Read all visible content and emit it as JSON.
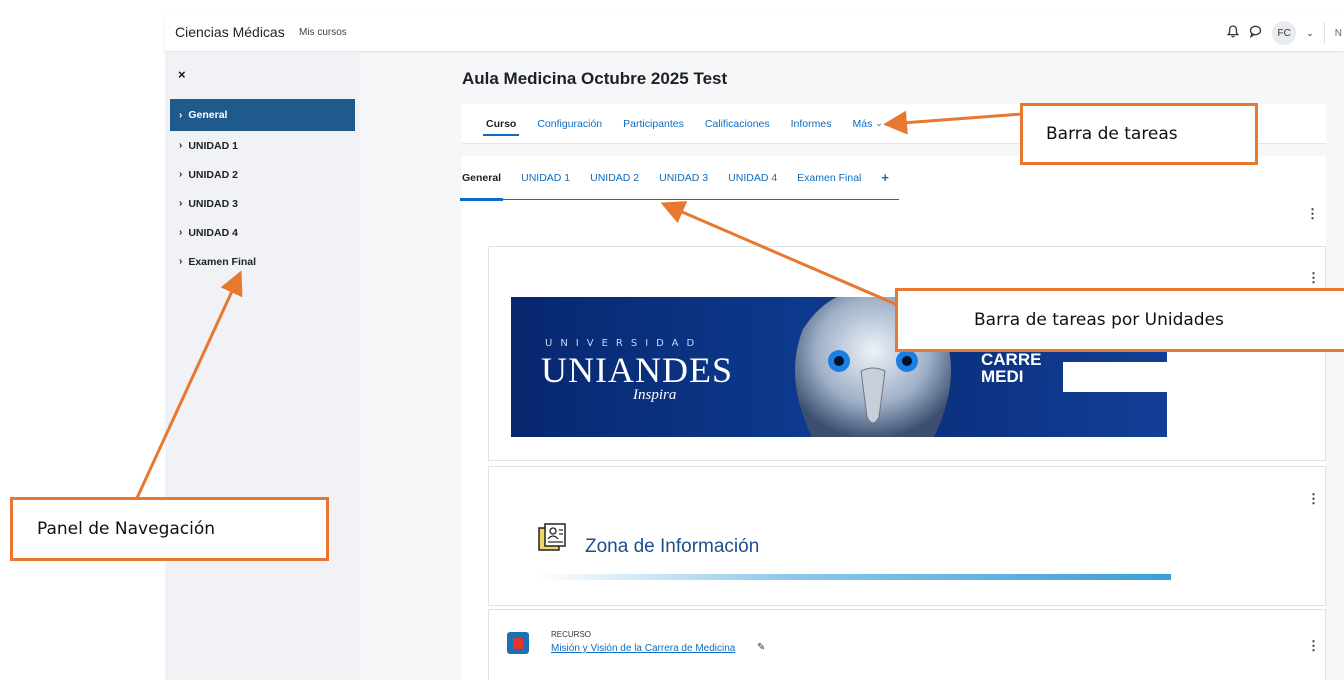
{
  "navbar": {
    "brand": "Ciencias Médicas",
    "link_mycourses": "Mis cursos",
    "avatar_initials": "FC",
    "cut_text": "N"
  },
  "drawer": {
    "close": "×",
    "items": [
      {
        "label": "General",
        "active": true
      },
      {
        "label": "UNIDAD 1"
      },
      {
        "label": "UNIDAD 2"
      },
      {
        "label": "UNIDAD 3"
      },
      {
        "label": "UNIDAD 4"
      },
      {
        "label": "Examen Final"
      }
    ]
  },
  "course": {
    "title": "Aula Medicina Octubre 2025 Test",
    "secondary_nav": [
      "Curso",
      "Configuración",
      "Participantes",
      "Calificaciones",
      "Informes",
      "Más"
    ],
    "unit_tabs": [
      "General",
      "UNIDAD 1",
      "UNIDAD 2",
      "UNIDAD 3",
      "UNIDAD 4",
      "Examen Final"
    ],
    "add_tab": "+"
  },
  "banner": {
    "university": "UNIVERSIDAD",
    "brand": "UNIANDES",
    "tagline": "Inspira",
    "career_line1": "CARRE",
    "career_line2": "MEDI"
  },
  "info_zone": {
    "title": "Zona de Información"
  },
  "resource": {
    "type": "RECURSO",
    "link": "Misión y Visión de la Carrera de Medicina"
  },
  "annotations": {
    "taskbar": "Barra de tareas",
    "unit_taskbar": "Barra de tareas por Unidades",
    "nav_panel": "Panel de Navegación"
  },
  "colors": {
    "accent": "#0f6cbf",
    "active_nav": "#1f5a8c",
    "annotation_border": "#e8782f"
  }
}
